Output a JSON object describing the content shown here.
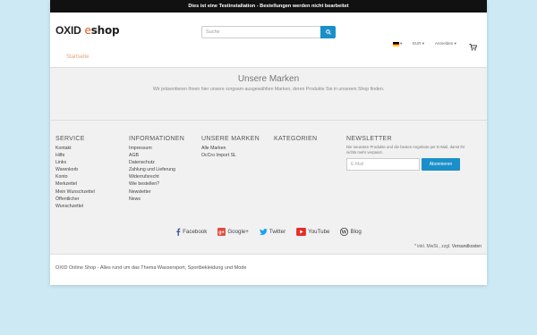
{
  "notice": "Dies ist eine Testinstallation - Bestellungen werden nicht bearbeitet",
  "logo": {
    "oxid": "OXID",
    "e": "e",
    "shop": "shop"
  },
  "search": {
    "placeholder": "Suche"
  },
  "header": {
    "currency": "EUR",
    "account": "Anmelden"
  },
  "nav": {
    "start": "Startseite"
  },
  "brands": {
    "title": "Unsere Marken",
    "text": "Wir präsentieren Ihnen hier unsere sorgsam ausgewählten Marken, deren Produkte Sie in unserem Shop finden."
  },
  "footer": {
    "service": {
      "title": "SERVICE",
      "items": [
        "Kontakt",
        "Hilfe",
        "Links",
        "Warenkorb",
        "Konto",
        "Merkzettel",
        "Mein Wunschzettel",
        "Öffentlicher",
        "Wunschzettel"
      ]
    },
    "information": {
      "title": "INFORMATIONEN",
      "items": [
        "Impressum",
        "AGB",
        "Datenschutz",
        "Zahlung und Lieferung",
        "Widerrufsrecht",
        "Wie bestellen?",
        "Newsletter",
        "News"
      ]
    },
    "brands": {
      "title": "UNSERE MARKEN",
      "items": [
        "Alle Marken",
        "OcCro Import SL"
      ]
    },
    "categories": {
      "title": "KATEGORIEN"
    },
    "newsletter": {
      "title": "NEWSLETTER",
      "text": "Die neuesten Produkte und die besten Angebote per E-Mail, damit Ihr nichts mehr verpasst.",
      "placeholder": "E-Mail",
      "button": "Abonnieren"
    }
  },
  "social": {
    "facebook": "Facebook",
    "google": "Google+",
    "twitter": "Twitter",
    "youtube": "YouTube",
    "blog": "Blog"
  },
  "vat": {
    "prefix": "* inkl. MwSt., zzgl.",
    "link": "Versandkosten"
  },
  "bottom": "OXID Online Shop - Alles rund um das Thema Wassersport, Sportbekleidung und Mode",
  "colors": {
    "accent": "#1b8fc9",
    "brand": "#e5561c",
    "background": "#cde9f4"
  }
}
